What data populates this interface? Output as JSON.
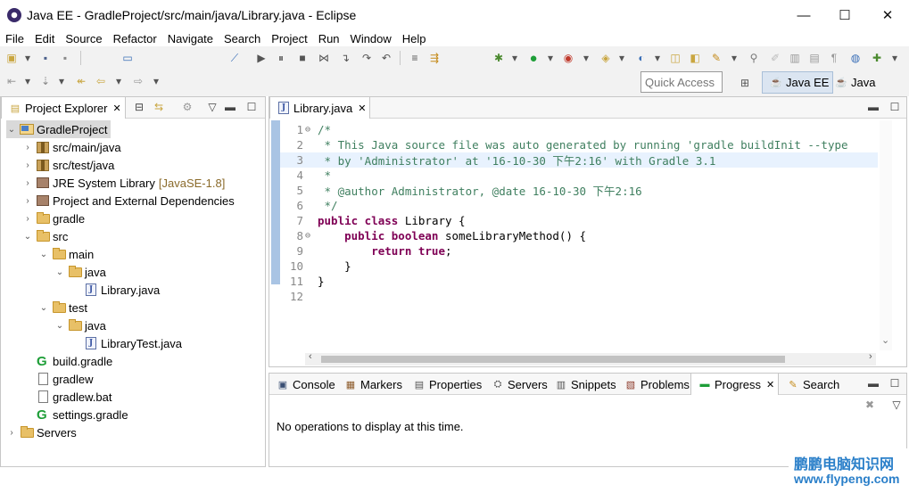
{
  "window": {
    "title": "Java EE - GradleProject/src/main/java/Library.java - Eclipse",
    "minimize_glyph": "—",
    "maximize_glyph": "☐",
    "close_glyph": "✕"
  },
  "menu": [
    "File",
    "Edit",
    "Source",
    "Refactor",
    "Navigate",
    "Search",
    "Project",
    "Run",
    "Window",
    "Help"
  ],
  "toolbar": {
    "quick_access_placeholder": "Quick Access",
    "perspectives": [
      {
        "label": "Java EE",
        "icon": "java-ee-perspective-icon",
        "active": true
      },
      {
        "label": "Java",
        "icon": "java-perspective-icon",
        "active": false
      }
    ]
  },
  "project_explorer": {
    "title": "Project Explorer",
    "close_glyph": "✕",
    "items": [
      {
        "label": "GradleProject",
        "icon": "project-icon",
        "depth": 0,
        "arrow": "⌄",
        "selected": true
      },
      {
        "label": "src/main/java",
        "icon": "package-folder-icon",
        "depth": 1,
        "arrow": "›"
      },
      {
        "label": "src/test/java",
        "icon": "package-folder-icon",
        "depth": 1,
        "arrow": "›"
      },
      {
        "label": "JRE System Library",
        "suffix": "[JavaSE-1.8]",
        "icon": "library-icon",
        "depth": 1,
        "arrow": "›"
      },
      {
        "label": "Project and External Dependencies",
        "icon": "library-icon",
        "depth": 1,
        "arrow": "›"
      },
      {
        "label": "gradle",
        "icon": "folder-icon",
        "depth": 1,
        "arrow": "›"
      },
      {
        "label": "src",
        "icon": "folder-icon",
        "depth": 1,
        "arrow": "⌄"
      },
      {
        "label": "main",
        "icon": "folder-icon",
        "depth": 2,
        "arrow": "⌄"
      },
      {
        "label": "java",
        "icon": "folder-icon",
        "depth": 3,
        "arrow": "⌄"
      },
      {
        "label": "Library.java",
        "icon": "java-file-icon",
        "depth": 4,
        "arrow": ""
      },
      {
        "label": "test",
        "icon": "folder-icon",
        "depth": 2,
        "arrow": "⌄"
      },
      {
        "label": "java",
        "icon": "folder-icon",
        "depth": 3,
        "arrow": "⌄"
      },
      {
        "label": "LibraryTest.java",
        "icon": "java-file-icon",
        "depth": 4,
        "arrow": ""
      },
      {
        "label": "build.gradle",
        "icon": "gradle-icon",
        "depth": 1,
        "arrow": ""
      },
      {
        "label": "gradlew",
        "icon": "file-icon",
        "depth": 1,
        "arrow": ""
      },
      {
        "label": "gradlew.bat",
        "icon": "file-icon",
        "depth": 1,
        "arrow": ""
      },
      {
        "label": "settings.gradle",
        "icon": "gradle-icon",
        "depth": 1,
        "arrow": ""
      },
      {
        "label": "Servers",
        "icon": "folder-icon",
        "depth": 0,
        "arrow": "›"
      }
    ]
  },
  "editor": {
    "tab_label": "Library.java",
    "close_glyph": "✕",
    "lines": [
      {
        "num": "1",
        "marker": "⊖",
        "segments": [
          {
            "t": "/*",
            "c": "cm"
          }
        ]
      },
      {
        "num": "2",
        "marker": "",
        "segments": [
          {
            "t": " * This Java source file was auto generated by running 'gradle buildInit --type",
            "c": "cm"
          }
        ]
      },
      {
        "num": "3",
        "marker": "",
        "highlight": true,
        "segments": [
          {
            "t": " * by 'Administrator' at '16-10-30 下午2:16' with Gradle 3.1",
            "c": "cm"
          }
        ]
      },
      {
        "num": "4",
        "marker": "",
        "segments": [
          {
            "t": " *",
            "c": "cm"
          }
        ]
      },
      {
        "num": "5",
        "marker": "",
        "segments": [
          {
            "t": " * @author Administrator, @date 16-10-30 下午2:16",
            "c": "cm"
          }
        ]
      },
      {
        "num": "6",
        "marker": "",
        "segments": [
          {
            "t": " */",
            "c": "cm"
          }
        ]
      },
      {
        "num": "7",
        "marker": "",
        "segments": [
          {
            "t": "public class",
            "c": "kw"
          },
          {
            "t": " Library {",
            "c": "plain"
          }
        ]
      },
      {
        "num": "8",
        "marker": "⊖",
        "segments": [
          {
            "t": "    public boolean",
            "c": "kw"
          },
          {
            "t": " someLibraryMethod() {",
            "c": "plain"
          }
        ]
      },
      {
        "num": "9",
        "marker": "",
        "segments": [
          {
            "t": "        return true",
            "c": "kw"
          },
          {
            "t": ";",
            "c": "plain"
          }
        ]
      },
      {
        "num": "10",
        "marker": "",
        "segments": [
          {
            "t": "    }",
            "c": "plain"
          }
        ]
      },
      {
        "num": "11",
        "marker": "",
        "segments": [
          {
            "t": "}",
            "c": "plain"
          }
        ]
      },
      {
        "num": "12",
        "marker": "",
        "segments": []
      }
    ]
  },
  "bottom_panel": {
    "tabs": [
      {
        "label": "Console",
        "icon": "console-icon"
      },
      {
        "label": "Markers",
        "icon": "markers-icon"
      },
      {
        "label": "Properties",
        "icon": "properties-icon"
      },
      {
        "label": "Servers",
        "icon": "servers-icon"
      },
      {
        "label": "Snippets",
        "icon": "snippets-icon"
      },
      {
        "label": "Problems",
        "icon": "problems-icon"
      },
      {
        "label": "Progress",
        "icon": "progress-icon",
        "active": true
      },
      {
        "label": "Search",
        "icon": "search-icon"
      }
    ],
    "close_glyph": "✕",
    "message": "No operations to display at this time."
  },
  "watermark": {
    "line1": "鹏鹏电脑知识网",
    "line2": "www.flypeng.com"
  }
}
